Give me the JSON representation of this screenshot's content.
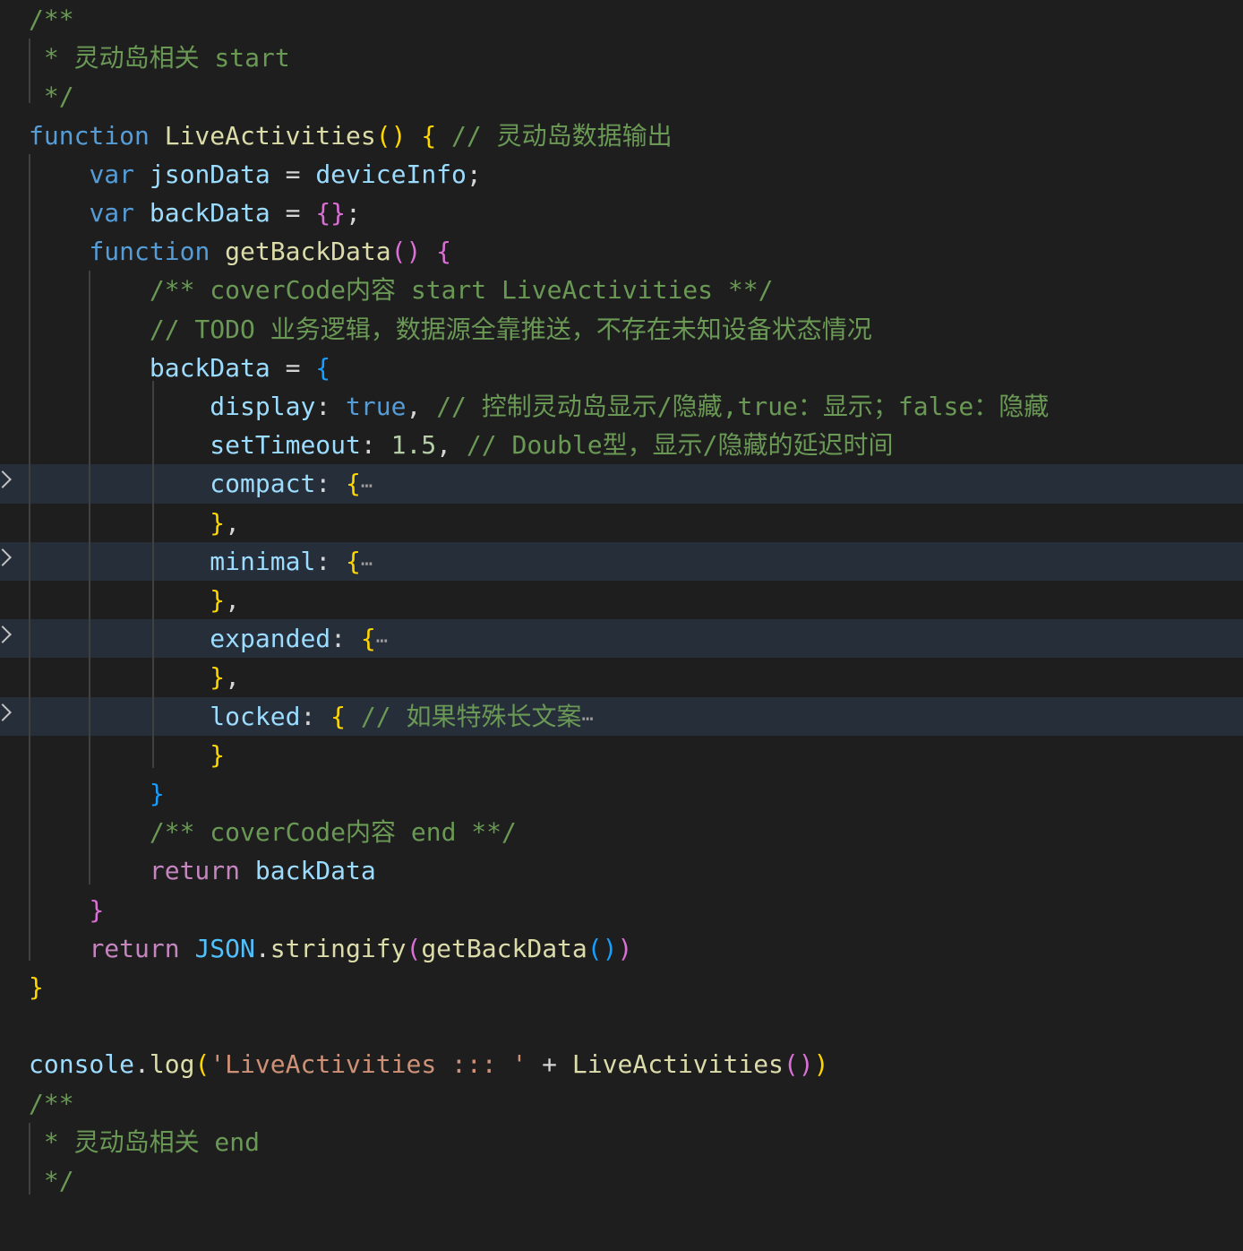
{
  "editor": {
    "theme": "dark",
    "colors": {
      "background": "#1e1e1e",
      "folded_highlight": "#262e3a",
      "comment": "#6a9955",
      "keyword": "#569cd6",
      "control": "#c586c0",
      "function": "#dcdcaa",
      "variable": "#9cdcfe",
      "constant": "#4fc1ff",
      "number": "#b5cea8",
      "string": "#ce9178",
      "bracket_1": "#ffd700",
      "bracket_2": "#da70d6",
      "bracket_3": "#179fff"
    },
    "folded_line_indices": [
      12,
      14,
      16,
      18
    ],
    "fold_icon": "chevron-right-icon",
    "lines": [
      [
        [
          "cm",
          "/**"
        ]
      ],
      [
        [
          "cm",
          " * 灵动岛相关 start"
        ]
      ],
      [
        [
          "cm",
          " */"
        ]
      ],
      [
        [
          "kw",
          "function"
        ],
        [
          "op",
          " "
        ],
        [
          "fn",
          "LiveActivities"
        ],
        [
          "b1",
          "()"
        ],
        [
          "op",
          " "
        ],
        [
          "b1",
          "{"
        ],
        [
          "op",
          " "
        ],
        [
          "cm",
          "// 灵动岛数据输出"
        ]
      ],
      [
        [
          "op",
          "    "
        ],
        [
          "kw",
          "var"
        ],
        [
          "op",
          " "
        ],
        [
          "var",
          "jsonData"
        ],
        [
          "op",
          " = "
        ],
        [
          "var",
          "deviceInfo"
        ],
        [
          "op",
          ";"
        ]
      ],
      [
        [
          "op",
          "    "
        ],
        [
          "kw",
          "var"
        ],
        [
          "op",
          " "
        ],
        [
          "var",
          "backData"
        ],
        [
          "op",
          " = "
        ],
        [
          "b2",
          "{}"
        ],
        [
          "op",
          ";"
        ]
      ],
      [
        [
          "op",
          "    "
        ],
        [
          "kw",
          "function"
        ],
        [
          "op",
          " "
        ],
        [
          "fn",
          "getBackData"
        ],
        [
          "b2",
          "()"
        ],
        [
          "op",
          " "
        ],
        [
          "b2",
          "{"
        ]
      ],
      [
        [
          "op",
          "        "
        ],
        [
          "cm",
          "/** coverCode内容 start LiveActivities **/"
        ]
      ],
      [
        [
          "op",
          "        "
        ],
        [
          "cm",
          "// TODO 业务逻辑，数据源全靠推送，不存在未知设备状态情况"
        ]
      ],
      [
        [
          "op",
          "        "
        ],
        [
          "var",
          "backData"
        ],
        [
          "op",
          " = "
        ],
        [
          "b3",
          "{"
        ]
      ],
      [
        [
          "op",
          "            "
        ],
        [
          "var",
          "display"
        ],
        [
          "op",
          ": "
        ],
        [
          "kw",
          "true"
        ],
        [
          "op",
          ", "
        ],
        [
          "cm",
          "// 控制灵动岛显示/隐藏,true：显示；false：隐藏"
        ]
      ],
      [
        [
          "op",
          "            "
        ],
        [
          "var",
          "setTimeout"
        ],
        [
          "op",
          ": "
        ],
        [
          "num",
          "1.5"
        ],
        [
          "op",
          ", "
        ],
        [
          "cm",
          "// Double型，显示/隐藏的延迟时间"
        ]
      ],
      [
        [
          "op",
          "            "
        ],
        [
          "var",
          "compact"
        ],
        [
          "op",
          ": "
        ],
        [
          "b1",
          "{"
        ],
        [
          "ell",
          "⋯"
        ]
      ],
      [
        [
          "op",
          "            "
        ],
        [
          "b1",
          "}"
        ],
        [
          "op",
          ","
        ]
      ],
      [
        [
          "op",
          "            "
        ],
        [
          "var",
          "minimal"
        ],
        [
          "op",
          ": "
        ],
        [
          "b1",
          "{"
        ],
        [
          "ell",
          "⋯"
        ]
      ],
      [
        [
          "op",
          "            "
        ],
        [
          "b1",
          "}"
        ],
        [
          "op",
          ","
        ]
      ],
      [
        [
          "op",
          "            "
        ],
        [
          "var",
          "expanded"
        ],
        [
          "op",
          ": "
        ],
        [
          "b1",
          "{"
        ],
        [
          "ell",
          "⋯"
        ]
      ],
      [
        [
          "op",
          "            "
        ],
        [
          "b1",
          "}"
        ],
        [
          "op",
          ","
        ]
      ],
      [
        [
          "op",
          "            "
        ],
        [
          "var",
          "locked"
        ],
        [
          "op",
          ": "
        ],
        [
          "b1",
          "{"
        ],
        [
          "op",
          " "
        ],
        [
          "cm",
          "// 如果特殊长文案"
        ],
        [
          "ell",
          "⋯"
        ]
      ],
      [
        [
          "op",
          "            "
        ],
        [
          "b1",
          "}"
        ]
      ],
      [
        [
          "op",
          "        "
        ],
        [
          "b3",
          "}"
        ]
      ],
      [
        [
          "op",
          "        "
        ],
        [
          "cm",
          "/** coverCode内容 end **/"
        ]
      ],
      [
        [
          "op",
          "        "
        ],
        [
          "ctrl",
          "return"
        ],
        [
          "op",
          " "
        ],
        [
          "var",
          "backData"
        ]
      ],
      [
        [
          "op",
          "    "
        ],
        [
          "b2",
          "}"
        ]
      ],
      [
        [
          "op",
          "    "
        ],
        [
          "ctrl",
          "return"
        ],
        [
          "op",
          " "
        ],
        [
          "const",
          "JSON"
        ],
        [
          "op",
          "."
        ],
        [
          "fn",
          "stringify"
        ],
        [
          "b2",
          "("
        ],
        [
          "fn",
          "getBackData"
        ],
        [
          "b3",
          "()"
        ],
        [
          "b2",
          ")"
        ]
      ],
      [
        [
          "b1",
          "}"
        ]
      ],
      [],
      [
        [
          "var",
          "console"
        ],
        [
          "op",
          "."
        ],
        [
          "fn",
          "log"
        ],
        [
          "b1",
          "("
        ],
        [
          "str",
          "'LiveActivities ::: '"
        ],
        [
          "op",
          " + "
        ],
        [
          "fn",
          "LiveActivities"
        ],
        [
          "b2",
          "()"
        ],
        [
          "b1",
          ")"
        ]
      ],
      [
        [
          "cm",
          "/**"
        ]
      ],
      [
        [
          "cm",
          " * 灵动岛相关 end"
        ]
      ],
      [
        [
          "cm",
          " */"
        ]
      ]
    ]
  }
}
